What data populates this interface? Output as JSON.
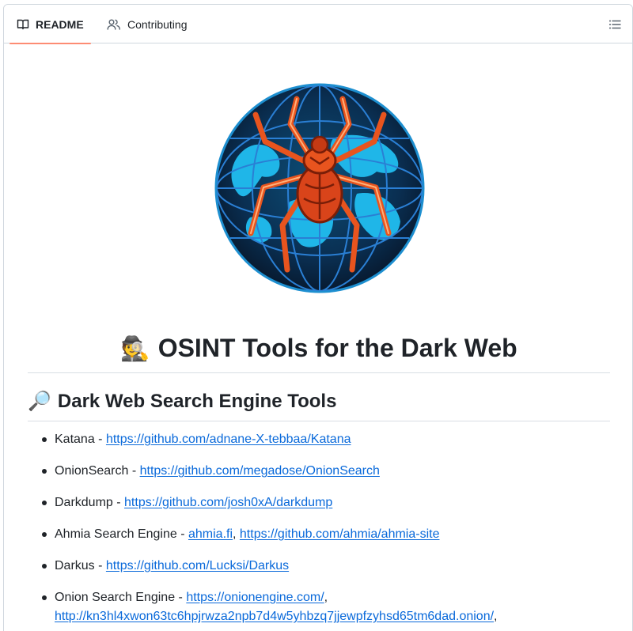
{
  "tabs": {
    "readme": "README",
    "contributing": "Contributing"
  },
  "icons": {
    "readme_tab": "book-icon",
    "contributing_tab": "people-icon",
    "outline": "list-unordered-icon",
    "title_emoji": "detective-emoji",
    "section_emoji": "magnifying-glass-emoji"
  },
  "logo": {
    "alt": "spider over globe logo"
  },
  "title": {
    "emoji": "🕵️",
    "text": "OSINT Tools for the Dark Web"
  },
  "section": {
    "emoji": "🔎",
    "text": "Dark Web Search Engine Tools"
  },
  "items": [
    {
      "name": "Katana",
      "sep": " - ",
      "links": [
        "https://github.com/adnane-X-tebbaa/Katana"
      ]
    },
    {
      "name": "OnionSearch",
      "sep": " - ",
      "links": [
        "https://github.com/megadose/OnionSearch"
      ]
    },
    {
      "name": "Darkdump",
      "sep": " - ",
      "links": [
        "https://github.com/josh0xA/darkdump"
      ]
    },
    {
      "name": "Ahmia Search Engine",
      "sep": " - ",
      "links": [
        "ahmia.fi",
        "https://github.com/ahmia/ahmia-site"
      ]
    },
    {
      "name": "Darkus",
      "sep": " - ",
      "links": [
        "https://github.com/Lucksi/Darkus"
      ]
    },
    {
      "name": "Onion Search Engine",
      "sep": " - ",
      "links": [
        "https://onionengine.com/",
        "http://kn3hl4xwon63tc6hpjrwza2npb7d4w5yhbzq7jjewpfzyhsd65tm6dad.onion/"
      ],
      "trailing": ","
    }
  ],
  "colors": {
    "link": "#0969da",
    "tab_underline": "#fd8c73",
    "text": "#1f2328",
    "border": "#d0d7de"
  }
}
